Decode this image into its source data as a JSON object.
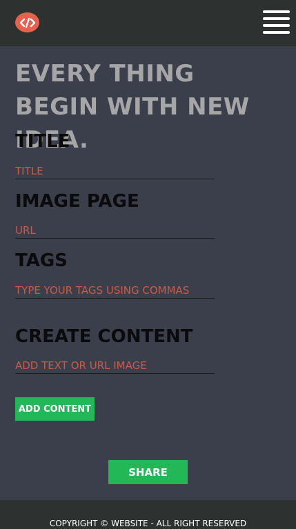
{
  "header": {
    "logo_icon": "code-brackets-icon",
    "menu_icon": "hamburger-menu-icon",
    "colors": {
      "bar": "#2d3230",
      "logo": "#e8604e"
    }
  },
  "main": {
    "headline": "EVERY THING BEGIN WITH NEW IDEA.",
    "title_label": "TITLE",
    "title_placeholder": "TITLE",
    "image_label": "IMAGE PAGE",
    "image_placeholder": "URL",
    "tags_label": "TAGS",
    "tags_placeholder": "TYPE YOUR TAGS USING COMMAS",
    "content_label": "CREATE CONTENT",
    "content_placeholder": "ADD TEXT OR URL IMAGE",
    "add_content_button": "ADD CONTENT",
    "share_button": "SHARE"
  },
  "footer": {
    "copyright": "COPYRIGHT © WEBSITE - ALL RIGHT RESERVED"
  },
  "colors": {
    "background": "#3a3f4b",
    "accent_green": "#22b857",
    "placeholder_red": "#c95c48",
    "headline_gray": "#a6a6a6"
  }
}
